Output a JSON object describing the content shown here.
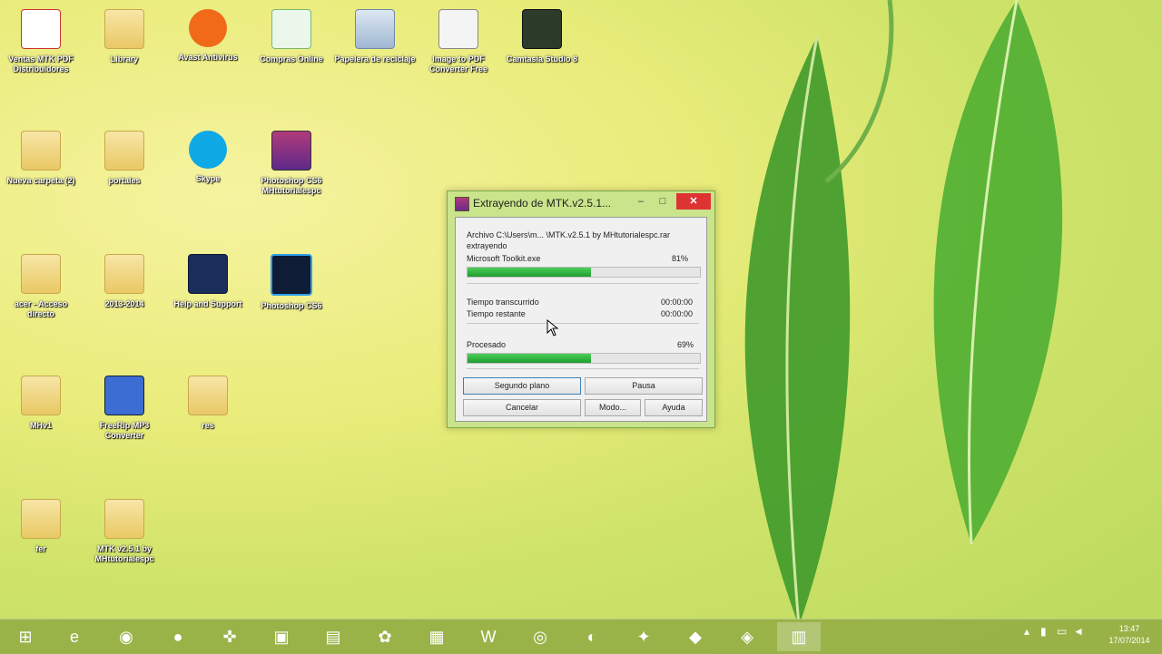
{
  "desktop_icons": [
    {
      "label": "Ventas MTK PDF Distribuidores",
      "icon": "pdf-icon"
    },
    {
      "label": "Library",
      "icon": "folder-icon"
    },
    {
      "label": "Avast Antivirus",
      "icon": "avast-icon"
    },
    {
      "label": "Compras Online",
      "icon": "acer-store-icon"
    },
    {
      "label": "Papelera de reciclaje",
      "icon": "recycle-bin-icon"
    },
    {
      "label": "Image to PDF Converter Free",
      "icon": "image-to-pdf-icon"
    },
    {
      "label": "Camtasia Studio 8",
      "icon": "camtasia-icon"
    },
    {
      "label": "Nueva carpeta (2)",
      "icon": "folder-icon"
    },
    {
      "label": "portales",
      "icon": "folder-icon"
    },
    {
      "label": "Skype",
      "icon": "skype-icon"
    },
    {
      "label": "Photoshop CS6 MHtutorialespc",
      "icon": "winrar-archive-icon"
    },
    {
      "label": "acer - Acceso directo",
      "icon": "user-folder-icon"
    },
    {
      "label": "2013-2014",
      "icon": "folder-icon"
    },
    {
      "label": "Help and Support",
      "icon": "help-icon"
    },
    {
      "label": "Photoshop CS6",
      "icon": "photoshop-icon"
    },
    {
      "label": "MHv1",
      "icon": "folder-icon"
    },
    {
      "label": "FreeRip MP3 Converter",
      "icon": "freerip-icon"
    },
    {
      "label": "res",
      "icon": "folder-icon"
    },
    {
      "label": "fer",
      "icon": "folder-icon"
    },
    {
      "label": "MTK v2.5.1 by MHtutorialespc",
      "icon": "folder-icon"
    }
  ],
  "dialog": {
    "title": "Extrayendo de MTK.v2.5.1...",
    "min_label": "–",
    "max_label": "□",
    "close_label": "✕",
    "archive_line": "Archivo C:\\Users\\m... \\MTK.v2.5.1 by MHtutorialespc.rar",
    "status": "extrayendo",
    "current_file": "Microsoft Toolkit.exe",
    "current_percent": "81%",
    "current_progress": 0.53,
    "elapsed_label": "Tiempo transcurrido",
    "elapsed_value": "00:00:00",
    "remaining_label": "Tiempo restante",
    "remaining_value": "00:00:00",
    "processed_label": "Procesado",
    "processed_percent": "69%",
    "processed_progress": 0.53,
    "buttons": {
      "background": "Segundo plano",
      "pause": "Pausa",
      "cancel": "Cancelar",
      "mode": "Modo...",
      "help": "Ayuda"
    }
  },
  "taskbar": {
    "items": [
      {
        "icon": "windows-start-icon",
        "glyph": "⊞"
      },
      {
        "icon": "internet-explorer-icon",
        "glyph": "e"
      },
      {
        "icon": "webcam-app-icon",
        "glyph": "◉"
      },
      {
        "icon": "media-player-icon",
        "glyph": "●"
      },
      {
        "icon": "gamepad-icon",
        "glyph": "✜"
      },
      {
        "icon": "outlook-icon",
        "glyph": "▣"
      },
      {
        "icon": "file-explorer-icon",
        "glyph": "▤"
      },
      {
        "icon": "paint-icon",
        "glyph": "✿"
      },
      {
        "icon": "photo-app-icon",
        "glyph": "▦"
      },
      {
        "icon": "word-icon",
        "glyph": "W"
      },
      {
        "icon": "chrome-icon",
        "glyph": "◎"
      },
      {
        "icon": "firefox-icon",
        "glyph": "◐"
      },
      {
        "icon": "filezilla-icon",
        "glyph": "✦"
      },
      {
        "icon": "camtasia-recorder-icon",
        "glyph": "◆"
      },
      {
        "icon": "camtasia-editor-icon",
        "glyph": "◈"
      },
      {
        "icon": "winrar-icon",
        "glyph": "▥"
      }
    ],
    "clock_time": "13:47",
    "clock_date": "17/07/2014"
  },
  "colors": {
    "progress": "#2aa83a",
    "close_button": "#d33333",
    "dialog_frame": "#c9e48a"
  }
}
